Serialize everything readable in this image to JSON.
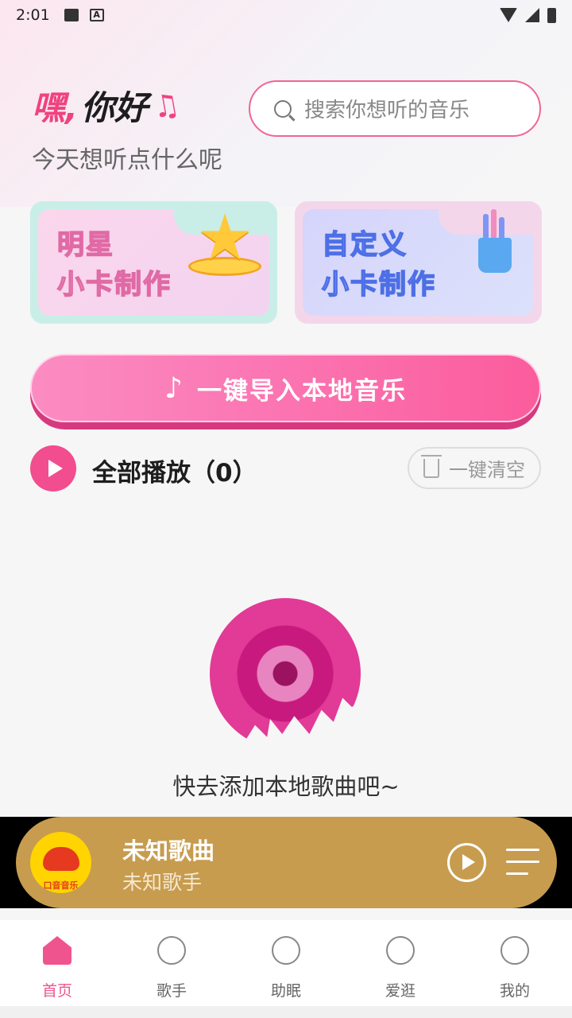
{
  "status_bar": {
    "time": "2:01"
  },
  "greeting": {
    "hey": "嘿,",
    "hello": "你好",
    "subtitle": "今天想听点什么呢"
  },
  "search": {
    "placeholder": "搜索你想听的音乐"
  },
  "cards": [
    {
      "title_line1": "明星",
      "title_line2": "小卡制作"
    },
    {
      "title_line1": "自定义",
      "title_line2": "小卡制作"
    }
  ],
  "import_button": {
    "label": "一键导入本地音乐"
  },
  "playlist": {
    "play_all_label": "全部播放（0）",
    "clear_label": "一键清空"
  },
  "empty_state": {
    "message": "快去添加本地歌曲吧~"
  },
  "player": {
    "title": "未知歌曲",
    "artist": "未知歌手",
    "cover_text": "口音音乐"
  },
  "nav": {
    "items": [
      {
        "label": "首页",
        "icon": "home-icon",
        "active": true
      },
      {
        "label": "歌手",
        "icon": "smile-icon",
        "active": false
      },
      {
        "label": "助眠",
        "icon": "moon-icon",
        "active": false
      },
      {
        "label": "爱逛",
        "icon": "heart-chat-icon",
        "active": false
      },
      {
        "label": "我的",
        "icon": "user-icon",
        "active": false
      }
    ]
  },
  "colors": {
    "accent": "#f0548e",
    "player_bg": "#c79c4f"
  }
}
